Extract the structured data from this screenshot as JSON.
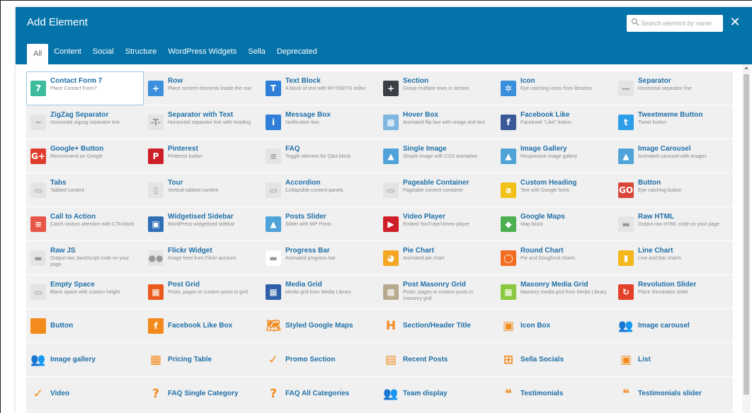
{
  "modal": {
    "title": "Add Element",
    "close_label": "✕",
    "search": {
      "placeholder": "Search element by name",
      "value": ""
    }
  },
  "tabs": [
    "All",
    "Content",
    "Social",
    "Structure",
    "WordPress Widgets",
    "Sella",
    "Deprecated"
  ],
  "active_tab": "All",
  "elements": [
    [
      {
        "name": "Contact Form 7",
        "desc": "Place Contact Form7",
        "icon": "contact-form-icon",
        "color": "#3cbc9c",
        "glyph": "7",
        "selected": true
      },
      {
        "name": "Row",
        "desc": "Place content elements inside the row",
        "icon": "row-icon",
        "color": "#3b8fdc",
        "glyph": "+"
      },
      {
        "name": "Text Block",
        "desc": "A block of text with WYSIWYG editor",
        "icon": "text-block-icon",
        "color": "#2f7fd9",
        "glyph": "T"
      },
      {
        "name": "Section",
        "desc": "Group multiple rows in section",
        "icon": "section-icon",
        "color": "#3b3f45",
        "glyph": "+"
      },
      {
        "name": "Icon",
        "desc": "Eye catching icons from libraries",
        "icon": "icon-element-icon",
        "color": "#3b8fdc",
        "glyph": "✲"
      },
      {
        "name": "Separator",
        "desc": "Horizontal separator line",
        "icon": "separator-icon",
        "color": "#e4e4e4",
        "glyph": "—"
      }
    ],
    [
      {
        "name": "ZigZag Separator",
        "desc": "Horizontal zigzag separator line",
        "icon": "zigzag-separator-icon",
        "color": "#e4e4e4",
        "glyph": "~"
      },
      {
        "name": "Separator with Text",
        "desc": "Horizontal separator line with heading",
        "icon": "separator-text-icon",
        "color": "#e4e4e4",
        "glyph": "-T-"
      },
      {
        "name": "Message Box",
        "desc": "Notification box",
        "icon": "message-box-icon",
        "color": "#2f7fd9",
        "glyph": "i"
      },
      {
        "name": "Hover Box",
        "desc": "Animated flip box with image and text",
        "icon": "hover-box-icon",
        "color": "#7fb6e0",
        "glyph": "▦"
      },
      {
        "name": "Facebook Like",
        "desc": "Facebook \"Like\" button",
        "icon": "facebook-like-icon",
        "color": "#3b5998",
        "glyph": "f"
      },
      {
        "name": "Tweetmeme Button",
        "desc": "Tweet button",
        "icon": "tweet-icon",
        "color": "#2d9fe8",
        "glyph": "t"
      }
    ],
    [
      {
        "name": "Google+ Button",
        "desc": "Recommend on Google",
        "icon": "google-plus-icon",
        "color": "#e03c2c",
        "glyph": "G+"
      },
      {
        "name": "Pinterest",
        "desc": "Pinterest button",
        "icon": "pinterest-icon",
        "color": "#cc1f27",
        "glyph": "P"
      },
      {
        "name": "FAQ",
        "desc": "Toggle element for Q&A block",
        "icon": "faq-icon",
        "color": "#e4e4e4",
        "glyph": "≡"
      },
      {
        "name": "Single Image",
        "desc": "Simple image with CSS animation",
        "icon": "single-image-icon",
        "color": "#4fa3d8",
        "glyph": "▲"
      },
      {
        "name": "Image Gallery",
        "desc": "Responsive image gallery",
        "icon": "image-gallery-icon",
        "color": "#4fa3d8",
        "glyph": "▲"
      },
      {
        "name": "Image Carousel",
        "desc": "Animated carousel with images",
        "icon": "image-carousel-icon",
        "color": "#4fa3d8",
        "glyph": "▲"
      }
    ],
    [
      {
        "name": "Tabs",
        "desc": "Tabbed content",
        "icon": "tabs-icon",
        "color": "#e4e4e4",
        "glyph": "▭"
      },
      {
        "name": "Tour",
        "desc": "Vertical tabbed content",
        "icon": "tour-icon",
        "color": "#e4e4e4",
        "glyph": "▯"
      },
      {
        "name": "Accordion",
        "desc": "Collapsible content panels",
        "icon": "accordion-icon",
        "color": "#e4e4e4",
        "glyph": "▭"
      },
      {
        "name": "Pageable Container",
        "desc": "Pageable content container",
        "icon": "pageable-container-icon",
        "color": "#e4e4e4",
        "glyph": "▭"
      },
      {
        "name": "Custom Heading",
        "desc": "Text with Google fonts",
        "icon": "custom-heading-icon",
        "color": "#f2c118",
        "glyph": "a"
      },
      {
        "name": "Button",
        "desc": "Eye catching button",
        "icon": "button-icon",
        "color": "#d94639",
        "glyph": "GO"
      }
    ],
    [
      {
        "name": "Call to Action",
        "desc": "Catch visitors attention with CTA block",
        "icon": "call-to-action-icon",
        "color": "#e65545",
        "glyph": "≡"
      },
      {
        "name": "Widgetised Sidebar",
        "desc": "WordPress widgetised sidebar",
        "icon": "widget-sidebar-icon",
        "color": "#2f6fb5",
        "glyph": "▣"
      },
      {
        "name": "Posts Slider",
        "desc": "Slider with WP Posts",
        "icon": "posts-slider-icon",
        "color": "#4fa3d8",
        "glyph": "▲"
      },
      {
        "name": "Video Player",
        "desc": "Embed YouTube/Vimeo player",
        "icon": "video-player-icon",
        "color": "#cc1f27",
        "glyph": "▶"
      },
      {
        "name": "Google Maps",
        "desc": "Map block",
        "icon": "google-maps-icon",
        "color": "#4caf50",
        "glyph": "◆"
      },
      {
        "name": "Raw HTML",
        "desc": "Output raw HTML code on your page",
        "icon": "raw-html-icon",
        "color": "#e4e4e4",
        "glyph": "▬"
      }
    ],
    [
      {
        "name": "Raw JS",
        "desc": "Output raw JavaScript code on your page",
        "icon": "raw-js-icon",
        "color": "#e4e4e4",
        "glyph": "▬"
      },
      {
        "name": "Flickr Widget",
        "desc": "Image feed from Flickr account",
        "icon": "flickr-icon",
        "color": "#e4e4e4",
        "glyph": "●●"
      },
      {
        "name": "Progress Bar",
        "desc": "Animated progress bar",
        "icon": "progress-bar-icon",
        "color": "#ffffff",
        "glyph": "▬"
      },
      {
        "name": "Pie Chart",
        "desc": "Animated pie chart",
        "icon": "pie-chart-icon",
        "color": "#f5a623",
        "glyph": "◕"
      },
      {
        "name": "Round Chart",
        "desc": "Pie and Doughnut charts",
        "icon": "round-chart-icon",
        "color": "#f36c21",
        "glyph": "◯"
      },
      {
        "name": "Line Chart",
        "desc": "Line and Bar charts",
        "icon": "line-chart-icon",
        "color": "#f5b81c",
        "glyph": "▮"
      }
    ],
    [
      {
        "name": "Empty Space",
        "desc": "Blank space with custom height",
        "icon": "empty-space-icon",
        "color": "#e4e4e4",
        "glyph": "▭"
      },
      {
        "name": "Post Grid",
        "desc": "Posts, pages or custom posts in grid",
        "icon": "post-grid-icon",
        "color": "#ea5a1e",
        "glyph": "▦"
      },
      {
        "name": "Media Grid",
        "desc": "Media grid from Media Library",
        "icon": "media-grid-icon",
        "color": "#2f5fa8",
        "glyph": "▦"
      },
      {
        "name": "Post Masonry Grid",
        "desc": "Posts, pages or custom posts in masonry grid",
        "icon": "post-masonry-grid-icon",
        "color": "#b7a98e",
        "glyph": "▦"
      },
      {
        "name": "Masonry Media Grid",
        "desc": "Masonry media grid from Media Library",
        "icon": "masonry-media-grid-icon",
        "color": "#8bc83f",
        "glyph": "▦"
      },
      {
        "name": "Revolution Slider",
        "desc": "Place Revolution slider",
        "icon": "revolution-slider-icon",
        "color": "#e4412b",
        "glyph": "↻"
      }
    ],
    [
      {
        "name": "Button",
        "icon": "square-button-icon",
        "color": "#f28a1c",
        "glyph": ""
      },
      {
        "name": "Facebook Like Box",
        "icon": "facebook-square-icon",
        "color": "#f28a1c",
        "glyph": "f"
      },
      {
        "name": "Styled Google Maps",
        "icon": "map-outline-icon",
        "color": "transparent",
        "glyph": "🗺",
        "glyph_color": "#f28a1c"
      },
      {
        "name": "Section/Header Title",
        "icon": "header-h-icon",
        "color": "transparent",
        "glyph": "H",
        "glyph_color": "#f28a1c"
      },
      {
        "name": "Icon Box",
        "icon": "icon-box-icon",
        "color": "transparent",
        "glyph": "▣",
        "glyph_color": "#f28a1c"
      },
      {
        "name": "Image carousel",
        "icon": "users-carousel-icon",
        "color": "transparent",
        "glyph": "👥",
        "glyph_color": "#f28a1c"
      }
    ],
    [
      {
        "name": "Image gallery",
        "icon": "users-gallery-icon",
        "color": "transparent",
        "glyph": "👥",
        "glyph_color": "#f28a1c"
      },
      {
        "name": "Pricing Table",
        "icon": "pricing-table-icon",
        "color": "transparent",
        "glyph": "▦",
        "glyph_color": "#f28a1c"
      },
      {
        "name": "Promo Section",
        "icon": "check-circle-icon",
        "color": "transparent",
        "glyph": "✓",
        "glyph_color": "#f28a1c"
      },
      {
        "name": "Recent Posts",
        "icon": "newspaper-icon",
        "color": "transparent",
        "glyph": "▤",
        "glyph_color": "#f28a1c"
      },
      {
        "name": "Sella Socials",
        "icon": "plus-square-icon",
        "color": "transparent",
        "glyph": "⊞",
        "glyph_color": "#f28a1c"
      },
      {
        "name": "List",
        "icon": "list-box-icon",
        "color": "transparent",
        "glyph": "▣",
        "glyph_color": "#f28a1c"
      }
    ],
    [
      {
        "name": "Video",
        "icon": "video-check-icon",
        "color": "transparent",
        "glyph": "✓",
        "glyph_color": "#f28a1c"
      },
      {
        "name": "FAQ Single Category",
        "icon": "question-circle-icon",
        "color": "transparent",
        "glyph": "?",
        "glyph_color": "#f28a1c"
      },
      {
        "name": "FAQ All Categories",
        "icon": "question-circle-icon",
        "color": "transparent",
        "glyph": "?",
        "glyph_color": "#f28a1c"
      },
      {
        "name": "Team display",
        "icon": "users-team-icon",
        "color": "transparent",
        "glyph": "👥",
        "glyph_color": "#f28a1c"
      },
      {
        "name": "Testimonials",
        "icon": "quote-icon",
        "color": "transparent",
        "glyph": "❝",
        "glyph_color": "#f28a1c"
      },
      {
        "name": "Testimonials slider",
        "icon": "quote-icon",
        "color": "transparent",
        "glyph": "❝",
        "glyph_color": "#f28a1c"
      }
    ]
  ]
}
